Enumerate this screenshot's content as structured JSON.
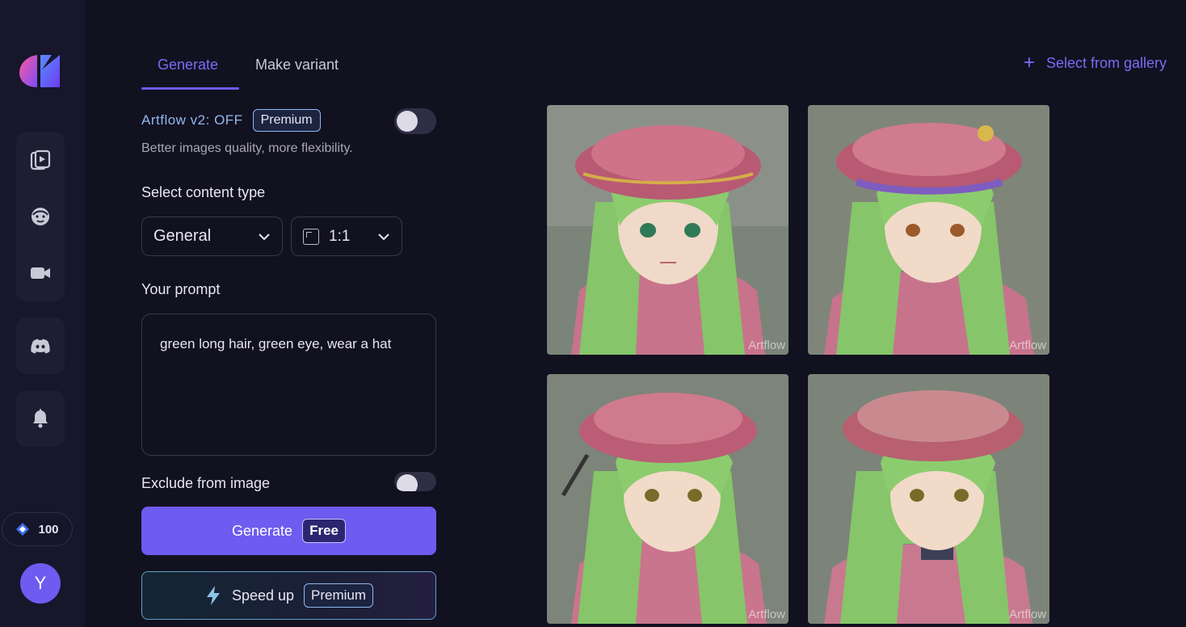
{
  "sidebar": {
    "logo": "artflow-logo",
    "group1": [
      {
        "icon": "story-player-icon"
      },
      {
        "icon": "character-face-icon"
      },
      {
        "icon": "video-camera-icon"
      }
    ],
    "discord": {
      "icon": "discord-icon"
    },
    "notifications": {
      "icon": "bell-icon"
    },
    "credits": {
      "icon": "diamond-icon",
      "value": "100"
    },
    "avatar_initial": "Y"
  },
  "tabs": {
    "generate": "Generate",
    "make_variant": "Make variant"
  },
  "gallery_link": "Select from gallery",
  "form": {
    "artflow_label": "Artflow v2: OFF",
    "premium_badge": "Premium",
    "artflow_hint": "Better images quality, more flexibility.",
    "content_type_label": "Select content type",
    "content_type_value": "General",
    "ratio_value": "1:1",
    "prompt_label": "Your prompt",
    "prompt_value": "green long hair, green eye, wear a hat",
    "exclude_label": "Exclude from image",
    "generate_label": "Generate",
    "generate_badge": "Free",
    "speed_label": "Speed up",
    "speed_badge": "Premium"
  },
  "images": [
    {
      "watermark": "Artflow"
    },
    {
      "watermark": "Artflow"
    },
    {
      "watermark": "Artflow"
    },
    {
      "watermark": "Artflow"
    }
  ],
  "colors": {
    "accent": "#6e5bf0",
    "background": "#121120",
    "rail": "#17162a",
    "link": "#7b6cf5"
  }
}
